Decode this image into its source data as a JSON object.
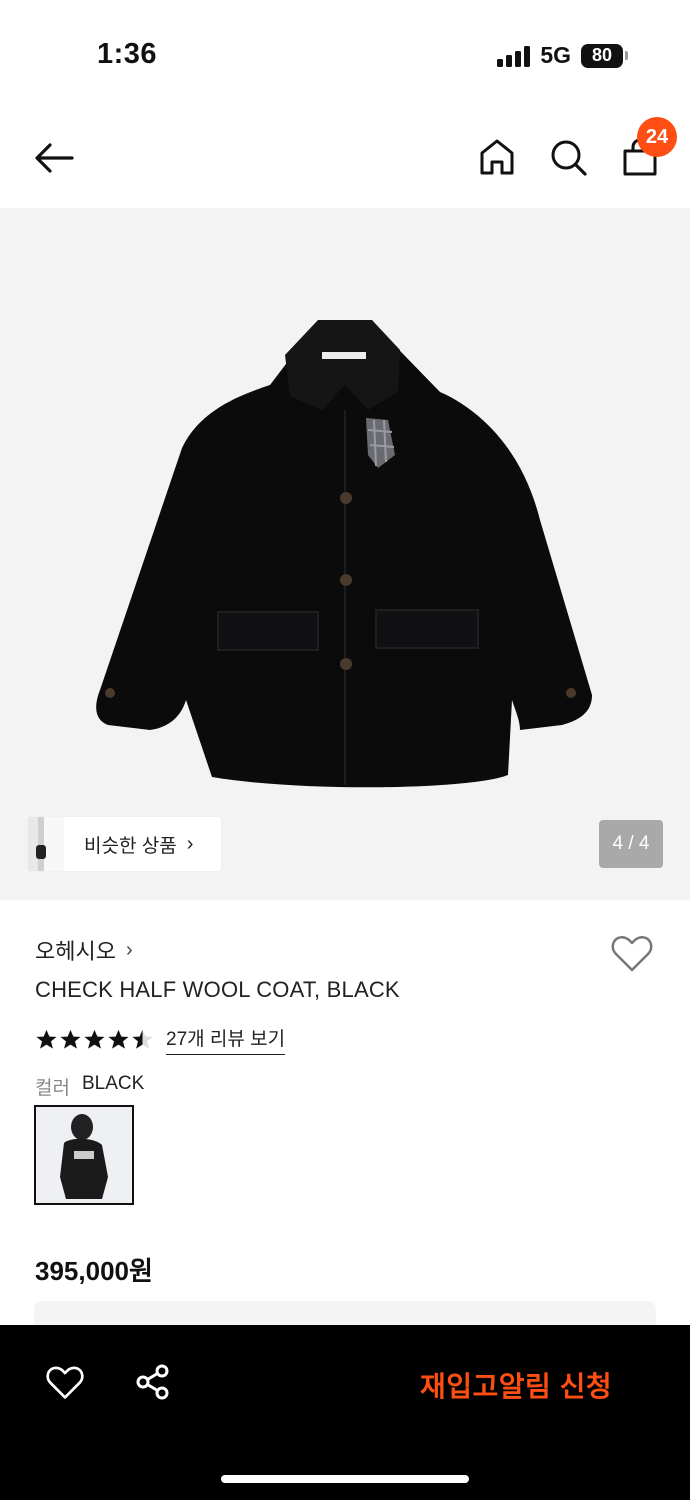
{
  "status_bar": {
    "time": "1:36",
    "network": "5G",
    "battery": "80",
    "signal_icon": "cellular-signal-icon"
  },
  "header": {
    "back_icon": "arrow-left-icon",
    "home_icon": "home-icon",
    "search_icon": "search-icon",
    "cart_icon": "shopping-bag-icon",
    "cart_count": "24",
    "badge_color": "#ff4e14"
  },
  "gallery": {
    "similar_label": "비슷한 상품",
    "similar_chevron": "›",
    "page_indicator": "4 / 4"
  },
  "product": {
    "brand": "오헤시오",
    "brand_chevron": "›",
    "title": "CHECK HALF WOOL COAT, BLACK",
    "rating": 4.5,
    "rating_max": 5,
    "review_link": "27개 리뷰 보기",
    "color_label": "컬러",
    "color_value": "BLACK",
    "price": "395,000원",
    "wish_icon": "heart-outline-icon"
  },
  "bottom_bar": {
    "wish_icon": "heart-outline-icon",
    "share_icon": "share-icon",
    "restock_label": "재입고알림 신청",
    "accent_color": "#ff4e14"
  }
}
